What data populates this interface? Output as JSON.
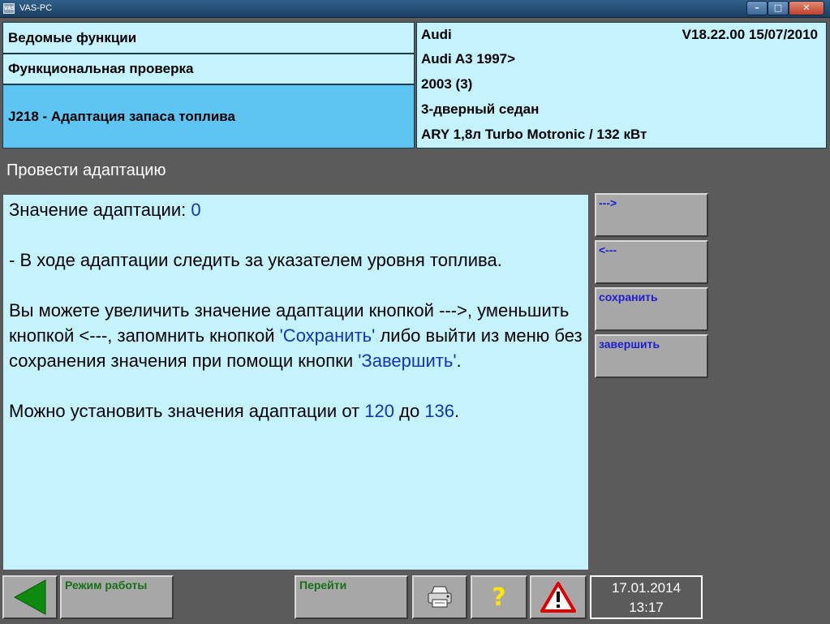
{
  "window": {
    "logo_text": "VAS",
    "title": "VAS-PC",
    "minimize_symbol": "–",
    "maximize_symbol": "□",
    "close_symbol": "✕"
  },
  "header": {
    "nav_guided": "Ведомые функции",
    "nav_functional": "Функциональная проверка",
    "nav_current": "J218 - Адаптация запаса топлива"
  },
  "vehicle": {
    "brand": "Audi",
    "version": "V18.22.00 15/07/2010",
    "model": "Audi A3 1997>",
    "year": "2003 (3)",
    "body": "3-дверный седан",
    "engine": "ARY 1,8л Turbo Motronic / 132 кВт"
  },
  "section_title": "Провести адаптацию",
  "content": {
    "value_label": "Значение адаптации: ",
    "value": "0",
    "para1": "- В ходе адаптации следить за указателем уровня топлива.",
    "para2_a": "Вы можете увеличить значение адаптации кнопкой --->, уменьшить кнопкой <---, запомнить кнопкой ",
    "para2_save": "'Сохранить'",
    "para2_b": " либо выйти из меню без сохранения значения при помощи кнопки ",
    "para2_finish": "'Завершить'",
    "para2_c": ".",
    "para3_a": "Можно установить значения адаптации от ",
    "range_min": "120",
    "para3_b": " до ",
    "range_max": "136",
    "para3_c": "."
  },
  "side_buttons": {
    "next": "--->",
    "prev": "<---",
    "save": "сохранить",
    "finish": "завершить"
  },
  "bottom_bar": {
    "mode": "Режим работы",
    "goto": "Перейти",
    "help": "?",
    "date": "17.01.2014",
    "time": "13:17"
  },
  "colors": {
    "panel_bg": "#c4f3ff",
    "selected_bg": "#5ec4f2",
    "desktop_bg": "#5b5b5b",
    "button_bg": "#a7a7a7",
    "side_button_text": "#1e1ecf",
    "bottom_button_text": "#157015",
    "back_arrow": "#0f8a10",
    "highlight_text": "#1434b8"
  },
  "icons": {
    "back": "back-arrow-icon",
    "print": "printer-icon",
    "help": "help-icon",
    "warning": "warning-icon"
  }
}
